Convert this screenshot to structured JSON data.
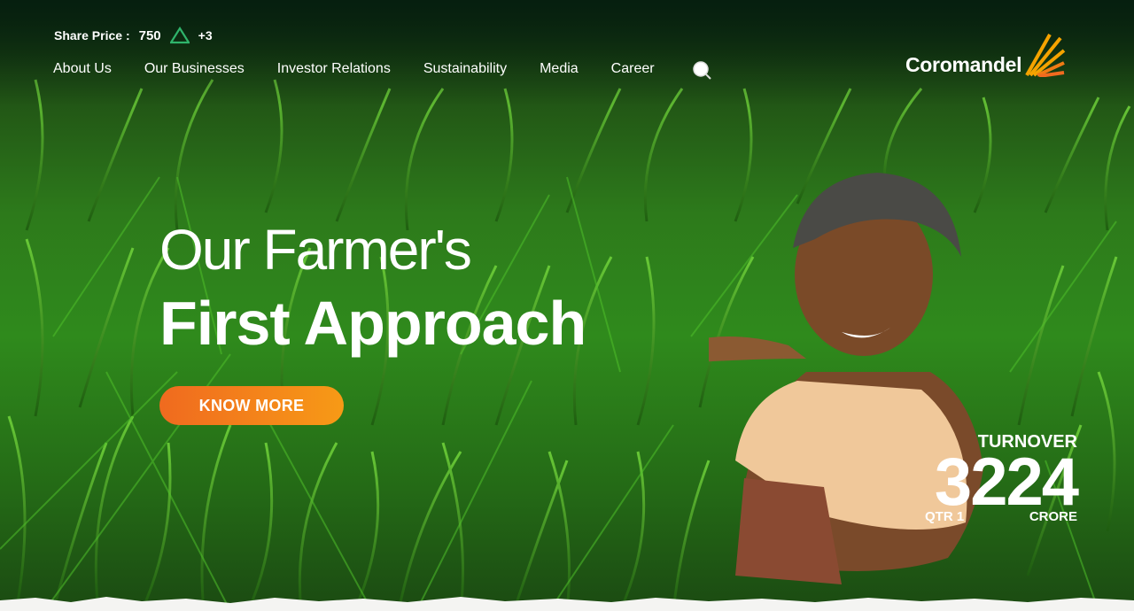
{
  "share": {
    "label": "Share Price :",
    "price": "750",
    "change": "+3",
    "trend_icon": "up-triangle-icon",
    "trend_color": "#2fb36b"
  },
  "nav": {
    "items": [
      {
        "label": "About Us"
      },
      {
        "label": "Our Businesses"
      },
      {
        "label": "Investor Relations"
      },
      {
        "label": "Sustainability"
      },
      {
        "label": "Media"
      },
      {
        "label": "Career"
      }
    ],
    "search_icon": "search-icon"
  },
  "brand": {
    "name": "Coromandel",
    "mark_colors": [
      "#f5a300",
      "#f06a1f"
    ]
  },
  "hero": {
    "line1": "Our Farmer's",
    "line2": "First Approach",
    "cta_label": "KNOW MORE",
    "cta_colors": [
      "#f06a1f",
      "#f79a16"
    ]
  },
  "stats": {
    "label": "TURNOVER",
    "value": "3224",
    "period": "QTR 1",
    "unit": "CRORE"
  }
}
